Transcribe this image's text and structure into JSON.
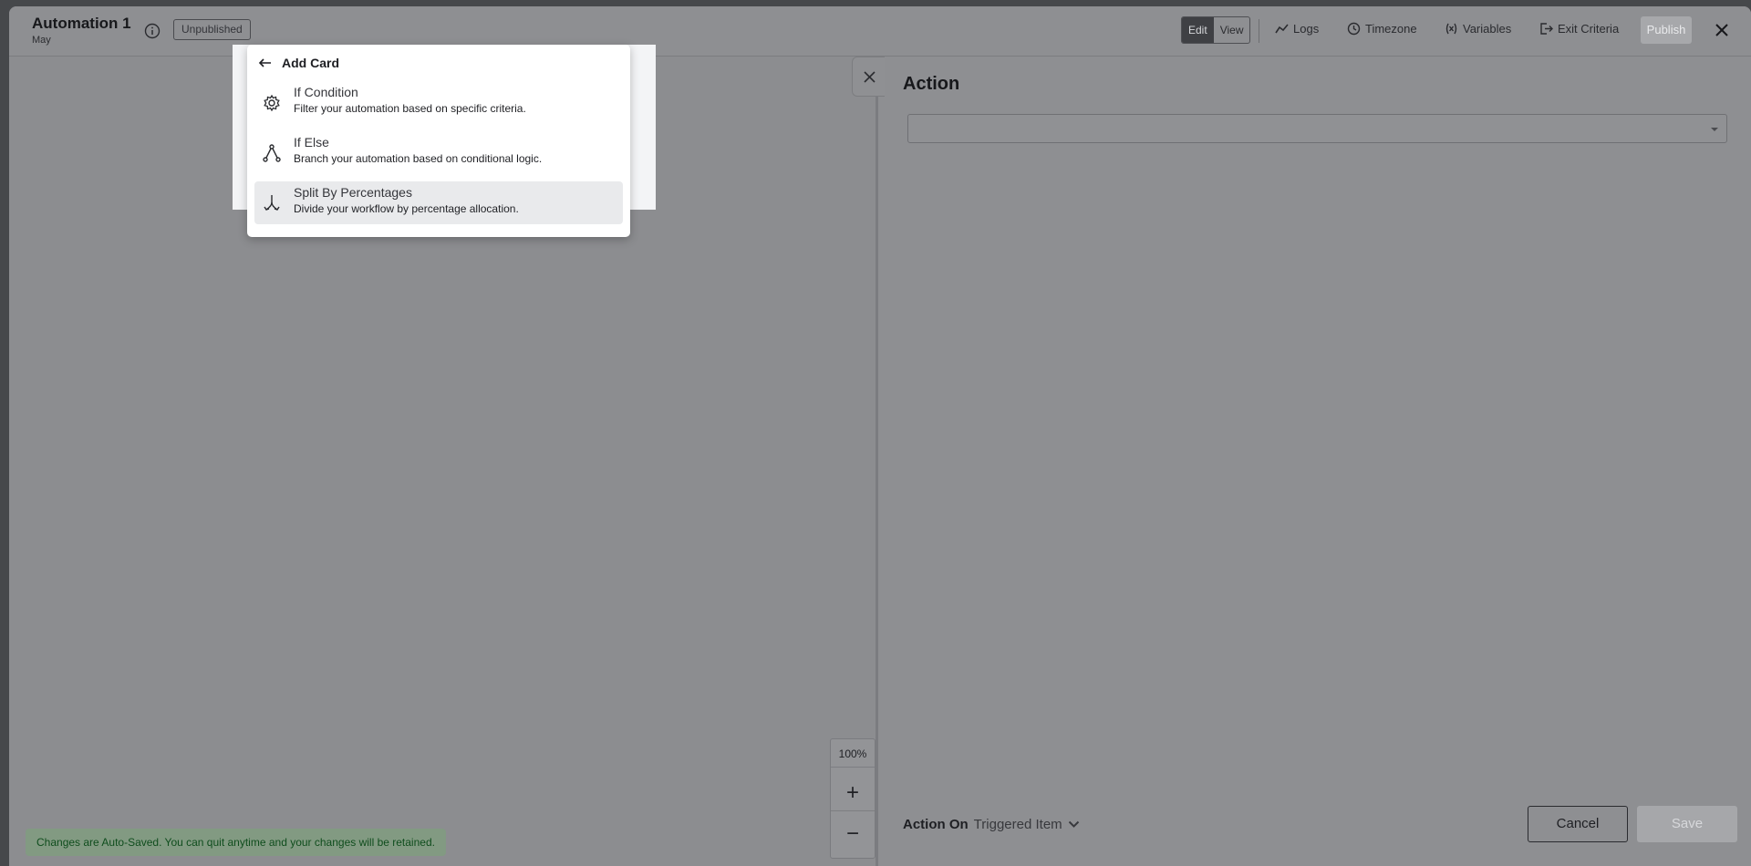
{
  "header": {
    "title": "Automation 1",
    "subtitle": "May",
    "status_badge": "Unpublished",
    "mode_edit": "Edit",
    "mode_view": "View",
    "logs": "Logs",
    "timezone": "Timezone",
    "variables": "Variables",
    "exit_criteria": "Exit Criteria",
    "publish": "Publish"
  },
  "add_card": {
    "title": "Add Card",
    "options": [
      {
        "name": "If Condition",
        "description": "Filter your automation based on specific criteria.",
        "icon": "gear-icon"
      },
      {
        "name": "If Else",
        "description": "Branch your automation based on conditional logic.",
        "icon": "branch-icon"
      },
      {
        "name": "Split By Percentages",
        "description": "Divide your workflow by percentage allocation.",
        "icon": "split-icon",
        "selected": true
      }
    ]
  },
  "canvas": {
    "zoom_level": "100%",
    "zoom_in": "+",
    "zoom_out": "−",
    "add_node": "+",
    "autosave_notice": "Changes are Auto-Saved. You can quit anytime and your changes will be retained."
  },
  "panel": {
    "title": "Action",
    "select_value": "",
    "action_on_label": "Action On",
    "action_on_value": "Triggered Item",
    "cancel": "Cancel",
    "save": "Save"
  },
  "colors": {
    "accent": "#0f9784",
    "overlay_dim": "#8c8d90"
  }
}
